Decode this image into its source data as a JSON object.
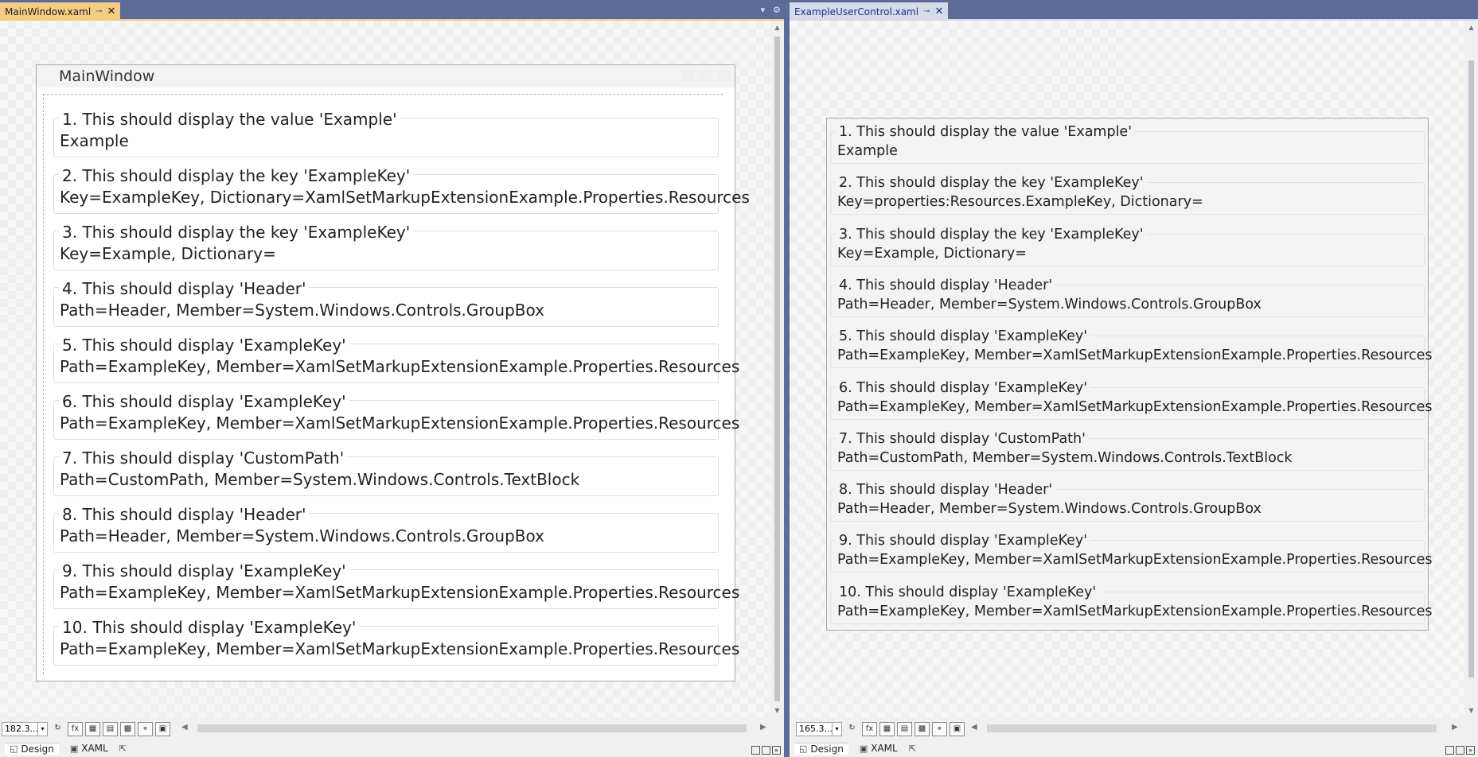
{
  "left": {
    "tab_title": "MainWindow.xaml",
    "window_title": "MainWindow",
    "zoom": "182.3...",
    "view_design": "Design",
    "view_xaml": "XAML",
    "groups": [
      {
        "header": "1. This should display the value 'Example'",
        "value": "Example"
      },
      {
        "header": "2. This should display the key 'ExampleKey'",
        "value": "Key=ExampleKey, Dictionary=XamlSetMarkupExtensionExample.Properties.Resources"
      },
      {
        "header": "3. This should display the key 'ExampleKey'",
        "value": "Key=Example, Dictionary="
      },
      {
        "header": "4. This should display 'Header'",
        "value": "Path=Header, Member=System.Windows.Controls.GroupBox"
      },
      {
        "header": "5. This should display 'ExampleKey'",
        "value": "Path=ExampleKey, Member=XamlSetMarkupExtensionExample.Properties.Resources"
      },
      {
        "header": "6. This should display 'ExampleKey'",
        "value": "Path=ExampleKey, Member=XamlSetMarkupExtensionExample.Properties.Resources"
      },
      {
        "header": "7. This should display 'CustomPath'",
        "value": "Path=CustomPath, Member=System.Windows.Controls.TextBlock"
      },
      {
        "header": "8. This should display 'Header'",
        "value": "Path=Header, Member=System.Windows.Controls.GroupBox"
      },
      {
        "header": "9. This should display 'ExampleKey'",
        "value": "Path=ExampleKey, Member=XamlSetMarkupExtensionExample.Properties.Resources"
      },
      {
        "header": "10. This should display 'ExampleKey'",
        "value": "Path=ExampleKey, Member=XamlSetMarkupExtensionExample.Properties.Resources"
      }
    ]
  },
  "right": {
    "tab_title": "ExampleUserControl.xaml",
    "zoom": "165.3...",
    "view_design": "Design",
    "view_xaml": "XAML",
    "groups": [
      {
        "header": "1. This should display the value 'Example'",
        "value": "Example"
      },
      {
        "header": "2. This should display the key 'ExampleKey'",
        "value": "Key=properties:Resources.ExampleKey, Dictionary="
      },
      {
        "header": "3. This should display the key 'ExampleKey'",
        "value": "Key=Example, Dictionary="
      },
      {
        "header": "4. This should display 'Header'",
        "value": "Path=Header, Member=System.Windows.Controls.GroupBox"
      },
      {
        "header": "5. This should display 'ExampleKey'",
        "value": "Path=ExampleKey, Member=XamlSetMarkupExtensionExample.Properties.Resources"
      },
      {
        "header": "6. This should display 'ExampleKey'",
        "value": "Path=ExampleKey, Member=XamlSetMarkupExtensionExample.Properties.Resources"
      },
      {
        "header": "7. This should display 'CustomPath'",
        "value": "Path=CustomPath, Member=System.Windows.Controls.TextBlock"
      },
      {
        "header": "8. This should display 'Header'",
        "value": "Path=Header, Member=System.Windows.Controls.GroupBox"
      },
      {
        "header": "9. This should display 'ExampleKey'",
        "value": "Path=ExampleKey, Member=XamlSetMarkupExtensionExample.Properties.Resources"
      },
      {
        "header": "10. This should display 'ExampleKey'",
        "value": "Path=ExampleKey, Member=XamlSetMarkupExtensionExample.Properties.Resources"
      }
    ]
  },
  "colors": {
    "chrome": "#5d6b99",
    "active_tab": "#f5cc84",
    "inactive_tab": "#d6dbe9"
  },
  "icons": {
    "pin": "pin-icon",
    "close": "close-icon",
    "settings": "gear-icon",
    "dropdown": "chevron-down-icon"
  }
}
